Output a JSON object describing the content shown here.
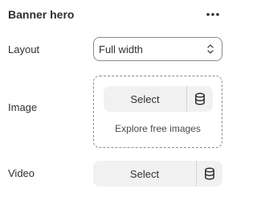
{
  "header": {
    "title": "Banner hero",
    "more_icon": "more-horizontal-icon"
  },
  "layout": {
    "label": "Layout",
    "selected": "Full width",
    "chevron_icon": "select-chevrons-icon"
  },
  "image": {
    "label": "Image",
    "select_label": "Select",
    "library_icon": "database-icon",
    "explore_label": "Explore free images"
  },
  "video": {
    "label": "Video",
    "select_label": "Select",
    "library_icon": "database-icon"
  },
  "colors": {
    "text": "#303030",
    "border": "#8a8a8a",
    "button_bg": "#f1f1f1"
  }
}
